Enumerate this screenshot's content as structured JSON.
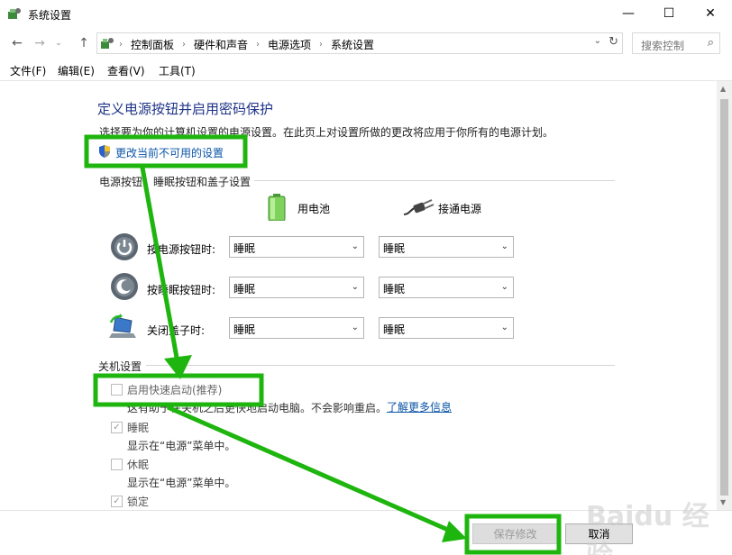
{
  "window": {
    "title": "系统设置",
    "minimize": "—",
    "maximize": "☐",
    "close": "✕"
  },
  "nav": {
    "back": "←",
    "forward": "→",
    "history": "⌄",
    "up": "↑",
    "breadcrumbs": [
      "控制面板",
      "硬件和声音",
      "电源选项",
      "系统设置"
    ],
    "separator": "›",
    "dropdown": "⌄",
    "refresh": "↻",
    "search_placeholder": "搜索控制",
    "search_icon": "⌕"
  },
  "menu": [
    "文件(F)",
    "编辑(E)",
    "查看(V)",
    "工具(T)"
  ],
  "content": {
    "heading": "定义电源按钮并启用密码保护",
    "description": "选择要为你的计算机设置的电源设置。在此页上对设置所做的更改将应用于你所有的电源计划。",
    "change_link": "更改当前不可用的设置",
    "power_group_title": "电源按钮、睡眠按钮和盖子设置",
    "col_battery": "用电池",
    "col_plugged": "接通电源",
    "rows": [
      {
        "label": "按电源按钮时:",
        "battery": "睡眠",
        "plugged": "睡眠",
        "icon": "power-button-icon"
      },
      {
        "label": "按睡眠按钮时:",
        "battery": "睡眠",
        "plugged": "睡眠",
        "icon": "sleep-button-icon"
      },
      {
        "label": "关闭盖子时:",
        "battery": "睡眠",
        "plugged": "睡眠",
        "icon": "laptop-lid-icon"
      }
    ],
    "shutdown_group_title": "关机设置",
    "fast_startup": {
      "label": "启用快速启动(推荐)",
      "desc": "这有助于在关机之后更快地启动电脑。不会影响重启。",
      "link": "了解更多信息",
      "checked": false
    },
    "sleep": {
      "label": "睡眠",
      "desc": "显示在“电源”菜单中。",
      "checked": true
    },
    "hibernate": {
      "label": "休眠",
      "desc": "显示在“电源”菜单中。",
      "checked": false
    },
    "lock": {
      "label": "锁定",
      "checked": true
    },
    "check_mark": "✓"
  },
  "footer": {
    "save": "保存修改",
    "cancel": "取消"
  },
  "annotation": {
    "color": "#1fb50f"
  },
  "watermark": "Baidu 经验"
}
